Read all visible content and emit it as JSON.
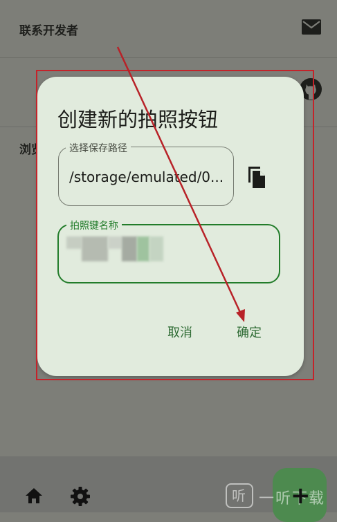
{
  "background_list": {
    "items": [
      {
        "label": "联系开发者",
        "icon": "mail-icon"
      },
      {
        "label": "浏览",
        "icon": "github-icon"
      }
    ]
  },
  "dialog": {
    "title": "创建新的拍照按钮",
    "path_field": {
      "label": "选择保存路径",
      "value": "/storage/emulated/0..."
    },
    "name_field": {
      "label": "拍照键名称",
      "value": ""
    },
    "copy_icon": "copy-icon",
    "cancel_label": "取消",
    "ok_label": "确定"
  },
  "bottom_nav": {
    "icons": [
      "home-icon",
      "settings-icon"
    ],
    "fab_label": "+"
  },
  "watermark": {
    "badge": "听",
    "text": "一听下载"
  },
  "colors": {
    "accent": "#227c2a",
    "dialog_bg": "#e1ebdd",
    "annotation": "#c4232a"
  }
}
